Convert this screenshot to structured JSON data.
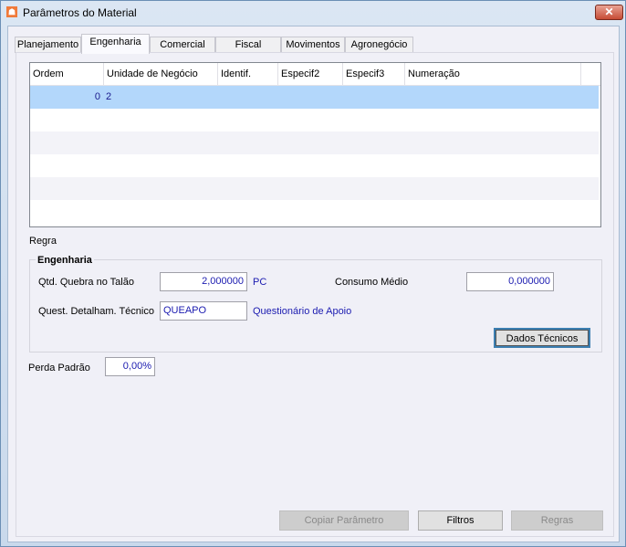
{
  "window": {
    "title": "Parâmetros do Material",
    "app_icon": "app-logo-icon",
    "close_icon": "close-icon"
  },
  "tabs": [
    {
      "label": "Planejamento"
    },
    {
      "label": "Engenharia",
      "active": true
    },
    {
      "label": "Comercial"
    },
    {
      "label": "Fiscal"
    },
    {
      "label": "Movimentos"
    },
    {
      "label": "Agronegócio"
    }
  ],
  "grid": {
    "columns": [
      "Ordem",
      "Unidade de Negócio",
      "Identif.",
      "Especif2",
      "Especif3",
      "Numeração"
    ],
    "rows": [
      {
        "ordem": "0",
        "unidade": "2"
      }
    ]
  },
  "regra_label": "Regra",
  "engenharia": {
    "title": "Engenharia",
    "qtd_quebra_label": "Qtd. Quebra no Talão",
    "qtd_quebra_value": "2,000000",
    "qtd_quebra_unit": "PC",
    "consumo_label": "Consumo Médio",
    "consumo_value": "0,000000",
    "quest_label": "Quest. Detalham. Técnico",
    "quest_value": "QUEAPO",
    "quest_desc": "Questionário de Apoio",
    "dados_tecnicos": "Dados Técnicos"
  },
  "perda_label": "Perda Padrão",
  "perda_value": "0,00%",
  "buttons": {
    "copiar": "Copiar Parâmetro",
    "filtros": "Filtros",
    "regras": "Regras"
  }
}
